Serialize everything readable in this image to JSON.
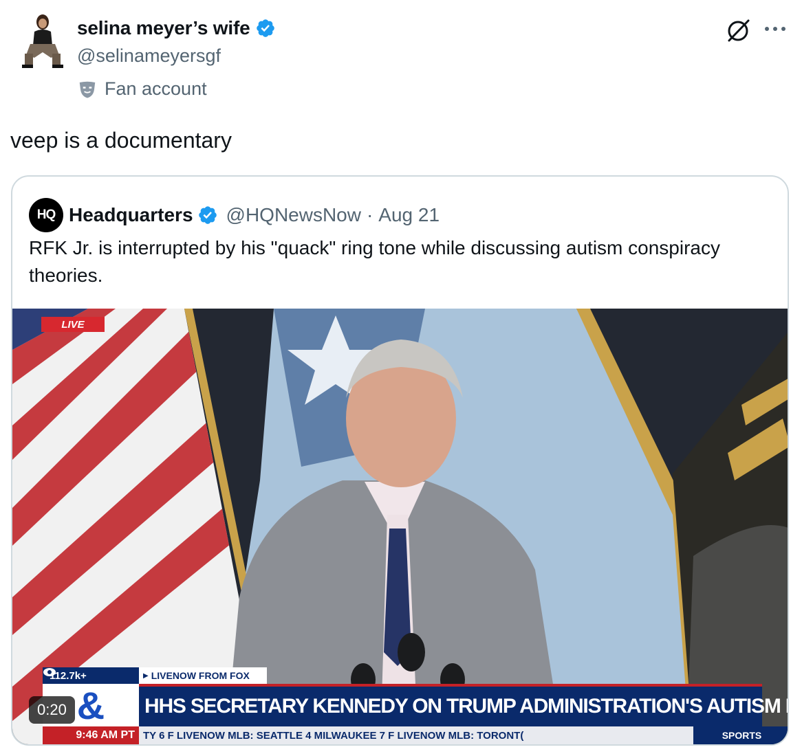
{
  "author": {
    "display_name": "selina meyer’s wife",
    "handle": "@selinameyersgf",
    "label": "Fan account",
    "verified_color": "#1d9bf0"
  },
  "tweet": {
    "text": "veep is a documentary"
  },
  "quoted_tweet": {
    "avatar_text": "HQ",
    "display_name": "Headquarters",
    "handle": "@HQNewsNow",
    "separator": "·",
    "date": "Aug 21",
    "text": "RFK Jr. is interrupted by his \"quack\" ring tone while discussing autism conspiracy theories."
  },
  "video": {
    "duration": "0:20",
    "live_tag": "LIVE",
    "views": "112.7k+",
    "source": "LIVENOW FROM FOX",
    "logo": "&",
    "headline": "HHS SECRETARY KENNEDY ON TRUMP ADMINISTRATION'S AUTISM EFFORTS",
    "time": "9:46 AM PT",
    "ticker": "TY   6   F    LIVENOW    MLB:   SEATTLE   4   MILWAUKEE   7   F    LIVENOW    MLB:   TORONT(",
    "sports_tag": "SPORTS"
  },
  "icons": {
    "grok": "grok-icon",
    "more": "more-icon",
    "verified": "verified-badge-icon",
    "fan": "fan-mask-icon"
  }
}
